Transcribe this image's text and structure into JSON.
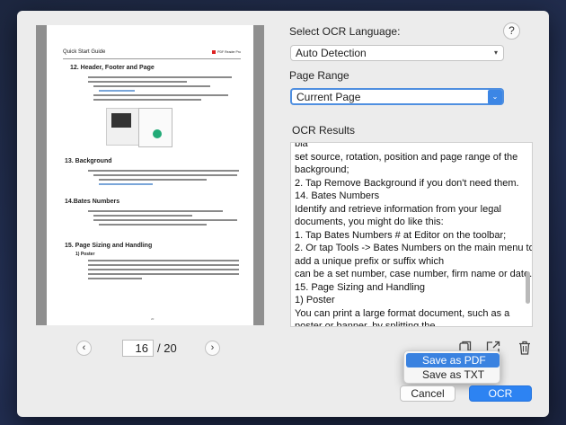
{
  "preview": {
    "header_left": "Quick Start Guide",
    "header_right": "PDF Reader Pro",
    "section_1": "12. Header, Footer and Page",
    "section_2": "13.    Background",
    "section_3": "14.Bates Numbers",
    "section_4": "15. Page Sizing and Handling",
    "subsection": "1) Poster",
    "page_number": "20"
  },
  "pagination": {
    "prev_icon": "chevron-left-icon",
    "next_icon": "chevron-right-icon",
    "current_page": "16",
    "total": "/ 20"
  },
  "language": {
    "label": "Select OCR Language:",
    "value": "Auto Detection",
    "help": "?"
  },
  "page_range": {
    "label": "Page Range",
    "value": "Current Page"
  },
  "results": {
    "label": "OCR Results",
    "text": "bla\nset source, rotation, position and page range of the\nbackground;\n2. Tap Remove Background if you don't need them.\n14. Bates Numbers\nIdentify and retrieve information from your legal\ndocuments, you might do like this:\n1. Tap Bates Numbers # at Editor on the toolbar;\n2. Or tap Tools -> Bates Numbers on the main menu to\nadd a unique prefix or suffix which\ncan be a set number, case number, firm name or date.\n15. Page Sizing and Handling\n1) Poster\nYou can print a large format document, such as a\nposter or banner, by splitting the\npage across multiple sheets of paper (called \"tiling\").\nThe poster option calculates how\nmany sheets of paper are needed. You can adjust the"
  },
  "toolbar_icons": {
    "copy": "copy-icon",
    "export": "export-icon",
    "delete": "trash-icon"
  },
  "save_menu": {
    "items": [
      "Save as PDF",
      "Save as TXT"
    ]
  },
  "buttons": {
    "cancel": "Cancel",
    "ocr": "OCR"
  },
  "colors": {
    "accent": "#2d83f2",
    "menu_highlight": "#3a82e0"
  }
}
